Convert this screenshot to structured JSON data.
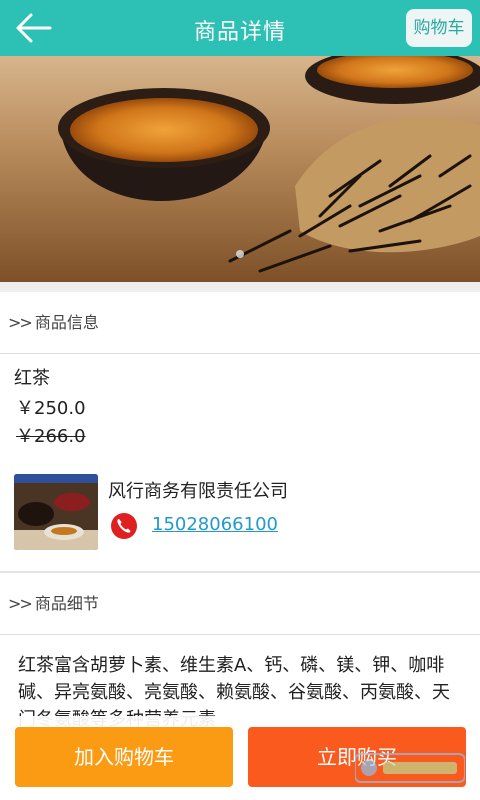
{
  "header": {
    "title": "商品详情",
    "cart_label": "购物车"
  },
  "banner": {
    "page_count": 1,
    "active_index": 0
  },
  "sections": {
    "info_title": "商品信息",
    "detail_title": "商品细节",
    "prefix": ">>"
  },
  "product": {
    "name": "红茶",
    "price": "￥250.0",
    "original_price": "￥266.0"
  },
  "shop": {
    "name": "风行商务有限责任公司",
    "phone": "15028066100"
  },
  "detail": {
    "text": "红茶富含胡萝卜素、维生素A、钙、磷、镁、钾、咖啡碱、异亮氨酸、亮氨酸、赖氨酸、谷氨酸、丙氨酸、天门冬氨酸等多种营养元素"
  },
  "actions": {
    "add_to_cart": "加入购物车",
    "buy_now": "立即购买"
  },
  "colors": {
    "header": "#2cc1b4",
    "add_to_cart": "#fb9a13",
    "buy_now": "#fb5a1e",
    "link": "#2299cc",
    "phone_icon": "#e02020"
  }
}
